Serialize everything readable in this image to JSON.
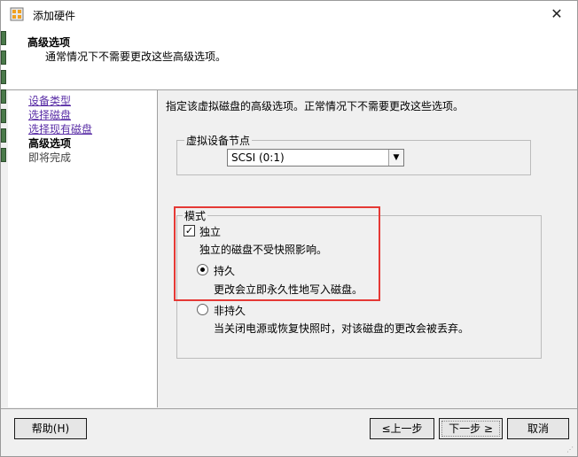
{
  "window": {
    "title": "添加硬件",
    "close_glyph": "✕"
  },
  "header": {
    "title": "高级选项",
    "subtitle": "通常情况下不需要更改这些高级选项。"
  },
  "nav": {
    "items": [
      {
        "label": "设备类型",
        "state": "link"
      },
      {
        "label": "选择磁盘",
        "state": "link"
      },
      {
        "label": "选择现有磁盘",
        "state": "link"
      },
      {
        "label": "高级选项",
        "state": "current"
      },
      {
        "label": "即将完成",
        "state": "pending"
      }
    ]
  },
  "content": {
    "intro": "指定该虚拟磁盘的高级选项。正常情况下不需要更改这些选项。",
    "device_node": {
      "legend": "虚拟设备节点",
      "selected": "SCSI (0:1)"
    },
    "mode": {
      "legend": "模式",
      "independent": {
        "label": "独立",
        "checked": true,
        "description": "独立的磁盘不受快照影响。"
      },
      "persistent": {
        "label": "持久",
        "selected": true,
        "description": "更改会立即永久性地写入磁盘。"
      },
      "nonpersistent": {
        "label": "非持久",
        "selected": false,
        "description": "当关闭电源或恢复快照时，对该磁盘的更改会被丢弃。"
      }
    }
  },
  "buttons": {
    "help": "帮助(H)",
    "back": "≤上一步",
    "next": "下一步 ≥",
    "cancel": "取消"
  },
  "colors": {
    "highlight_box": "#e53935",
    "link": "#5a2ea6"
  }
}
